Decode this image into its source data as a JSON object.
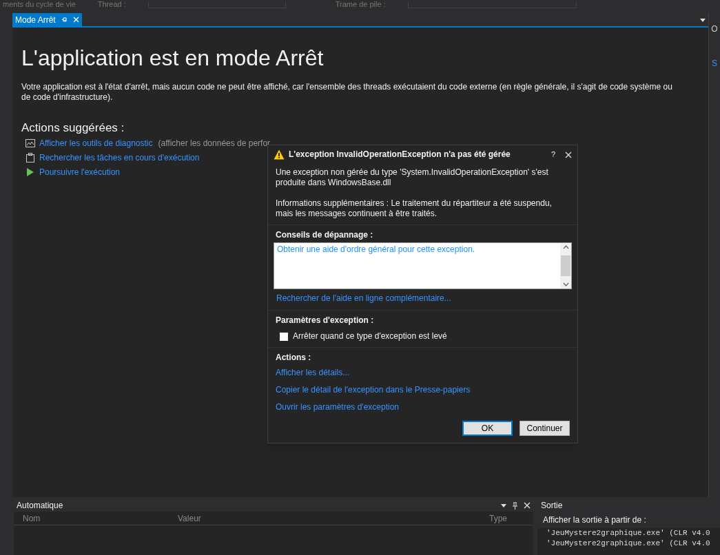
{
  "toolbar": {
    "labels": [
      "ments du cycle de vie",
      "Thread :",
      "Trame de pile :"
    ]
  },
  "tab": {
    "label": "Mode Arrêt",
    "selected": true
  },
  "side_letters": [
    "O",
    "S"
  ],
  "page": {
    "title": "L'application est en mode Arrêt",
    "description": "Votre application est à l'état d'arrêt, mais aucun code ne peut être affiché, car l'ensemble des threads exécutaient du code externe (en règle générale, il s'agit de code système ou de code d'infrastructure).",
    "actions_heading": "Actions suggérées :",
    "actions": [
      {
        "kind": "chart",
        "link": "Afficher les outils de diagnostic",
        "note": "(afficher les données de perfor"
      },
      {
        "kind": "clipboard",
        "link": "Rechercher les tâches en cours d'exécution"
      },
      {
        "kind": "play",
        "link": "Poursuivre l'exécution"
      }
    ]
  },
  "dialog": {
    "title": "L'exception InvalidOperationException n'a pas été gérée",
    "help": "?",
    "message": "Une exception non gérée du type 'System.InvalidOperationException' s'est produite dans WindowsBase.dll",
    "info": "Informations supplémentaires : Le traitement du répartiteur a été suspendu, mais les messages continuent à être traités.",
    "tips_heading": "Conseils de dépannage :",
    "tips": [
      "Obtenir une aide d'ordre général pour cette exception."
    ],
    "online_link": "Rechercher de l'aide en ligne complémentaire...",
    "settings_heading": "Paramètres d'exception :",
    "checkbox": {
      "label": "Arrêter quand ce type d'exception est levé",
      "checked": false
    },
    "actions_heading": "Actions :",
    "actions": [
      "Afficher les détails...",
      "Copier le détail de l'exception dans le Presse-papiers",
      "Ouvrir les paramètres d'exception"
    ],
    "buttons": [
      {
        "label": "OK",
        "selected": true
      },
      {
        "label": "Continuer",
        "selected": false
      }
    ]
  },
  "autos": {
    "title": "Automatique",
    "columns": [
      "Nom",
      "Valeur",
      "Type"
    ]
  },
  "output": {
    "title": "Sortie",
    "source_label": "Afficher la sortie à partir de :",
    "lines": [
      "'JeuMystere2graphique.exe' (CLR v4.0",
      "'JeuMystere2graphique.exe' (CLR v4.0"
    ]
  }
}
